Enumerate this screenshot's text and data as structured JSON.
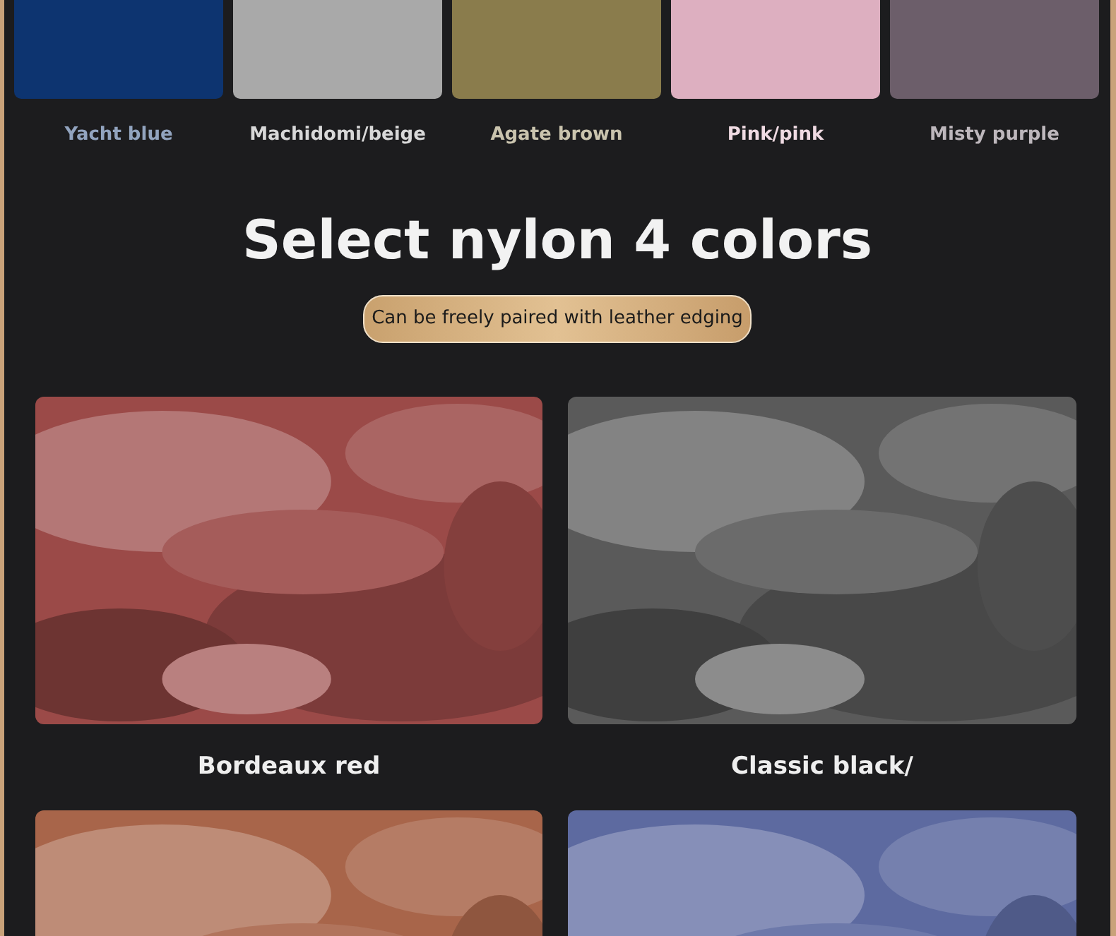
{
  "leather_swatches": [
    {
      "label": "Yacht blue",
      "color": "#0d3470"
    },
    {
      "label": "Machidomi/beige",
      "color": "#a9a9a9"
    },
    {
      "label": "Agate brown",
      "color": "#8a7c4c"
    },
    {
      "label": "Pink/pink",
      "color": "#ddafc0"
    },
    {
      "label": "Misty purple",
      "color": "#6c5e6a"
    }
  ],
  "section": {
    "title": "Select nylon 4 colors",
    "badge": "Can be freely paired with leather edging"
  },
  "nylon_swatches": [
    {
      "kind": "picture",
      "label": "Bordeaux red"
    },
    {
      "kind": "picture",
      "label": "Classic black/"
    },
    {
      "kind": "picture"
    },
    {
      "kind": "picture"
    }
  ]
}
